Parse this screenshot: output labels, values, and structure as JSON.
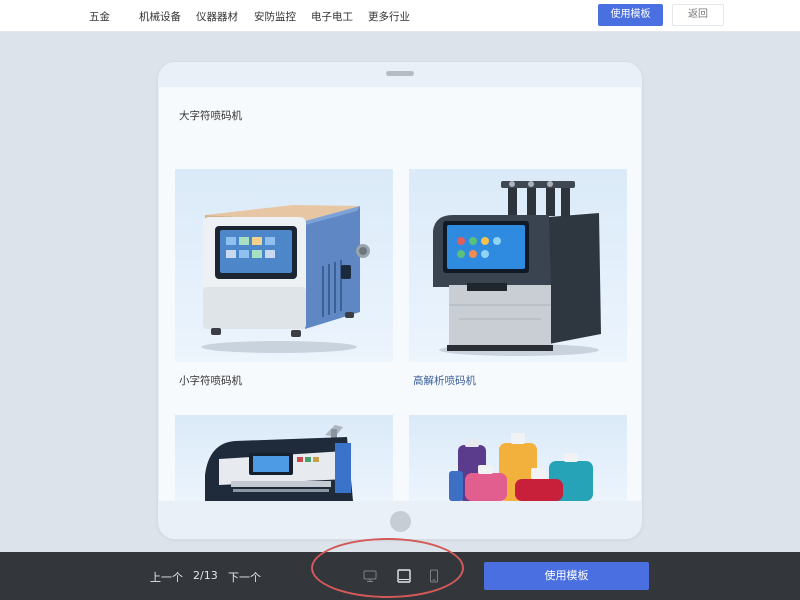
{
  "nav": {
    "items": [
      "五金",
      "机械设备",
      "仪器器材",
      "安防监控",
      "电子电工",
      "更多行业"
    ],
    "use_template_label": "使用模板",
    "back_label": "返回"
  },
  "preview": {
    "section_title": "大字符喷码机",
    "cards": [
      {
        "label": "小字符喷码机"
      },
      {
        "label": "高解析喷码机"
      }
    ]
  },
  "pager": {
    "prev_label": "上一个",
    "indicator": "2/13",
    "next_label": "下一个"
  },
  "device_icons": [
    "desktop-icon",
    "tablet-icon",
    "phone-icon"
  ],
  "bottom_use_template_label": "使用模板",
  "colors": {
    "accent": "#4a6fe0",
    "link": "#3a5f9a",
    "bottom_bar": "#33363b",
    "highlight": "#d45a5a"
  }
}
